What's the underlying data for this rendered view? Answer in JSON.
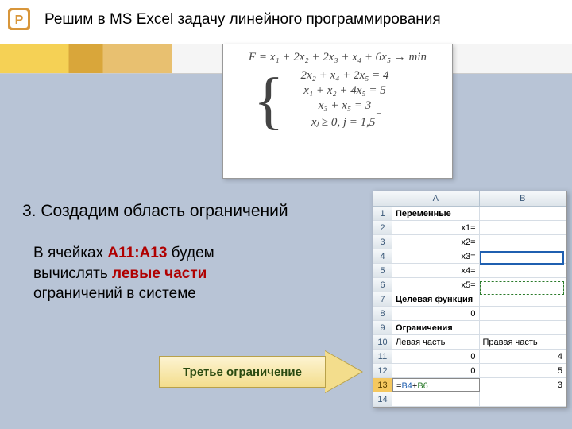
{
  "title": "Решим в MS Excel задачу линейного программирования",
  "equation": {
    "objective": "F = x₁ + 2x₂ + 2x₃ + x₄ + 6x₅ → min",
    "c1": "2x₂ + x₄ + 2x₅ = 4",
    "c2": "x₁ + x₂ + 4x₅ = 5",
    "c3": "x₃ + x₅ = 3",
    "nn": "xⱼ ≥ 0,  j = 1,5"
  },
  "section_title": "3. Создадим область ограничений",
  "body": {
    "p1a": "В ячейках ",
    "p1b": "А11:A13",
    "p1c": " будем",
    "p2a": "вычислять ",
    "p2b": "левые части",
    "p3": "ограничений в системе"
  },
  "callout": "Третье ограничение",
  "excel": {
    "cols": [
      "A",
      "B"
    ],
    "rows": [
      {
        "n": "1",
        "a": "Переменные",
        "b": "",
        "abold": true
      },
      {
        "n": "2",
        "a": "x1=",
        "b": "",
        "aright": true
      },
      {
        "n": "3",
        "a": "x2=",
        "b": "",
        "aright": true
      },
      {
        "n": "4",
        "a": "x3=",
        "b": "",
        "aright": true
      },
      {
        "n": "5",
        "a": "x4=",
        "b": "",
        "aright": true
      },
      {
        "n": "6",
        "a": "x5=",
        "b": "",
        "aright": true
      },
      {
        "n": "7",
        "a": "Целевая функция",
        "b": "",
        "abold": true
      },
      {
        "n": "8",
        "a": "0",
        "b": "",
        "aright": true
      },
      {
        "n": "9",
        "a": "Ограничения",
        "b": "",
        "abold": true
      },
      {
        "n": "10",
        "a": "Левая часть",
        "b": "Правая часть"
      },
      {
        "n": "11",
        "a": "0",
        "b": "4",
        "aright": true,
        "bright": true
      },
      {
        "n": "12",
        "a": "0",
        "b": "5",
        "aright": true,
        "bright": true
      },
      {
        "n": "13",
        "a": "=B4+B6",
        "b": "3",
        "bright": true,
        "formula": true,
        "sel": true
      },
      {
        "n": "14",
        "a": "",
        "b": ""
      }
    ]
  }
}
